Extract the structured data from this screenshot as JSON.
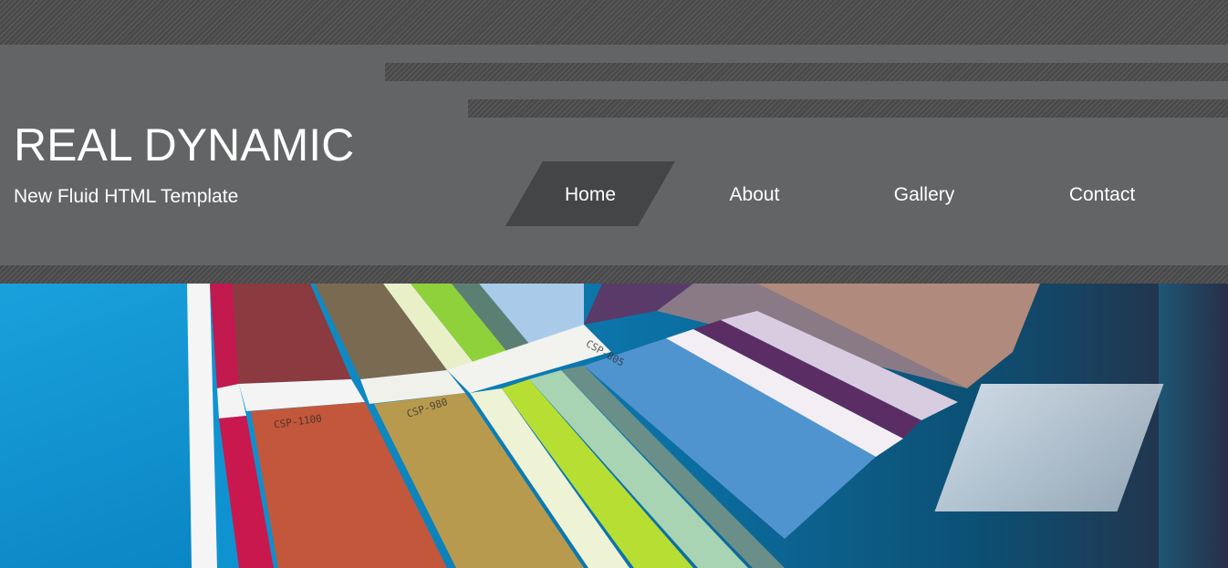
{
  "header": {
    "title": "REAL DYNAMIC",
    "subtitle": "New Fluid HTML Template"
  },
  "nav": {
    "items": [
      {
        "label": "Home",
        "active": true
      },
      {
        "label": "About",
        "active": false
      },
      {
        "label": "Gallery",
        "active": false
      },
      {
        "label": "Contact",
        "active": false
      }
    ]
  },
  "hero": {
    "swatch_labels": [
      "CSP-1100",
      "CSP-980",
      "CSP-805"
    ]
  },
  "colors": {
    "header_bg": "#636466",
    "stripe_bg": "#4a4a4b",
    "nav_active_bg": "#444547",
    "text": "#ffffff"
  }
}
